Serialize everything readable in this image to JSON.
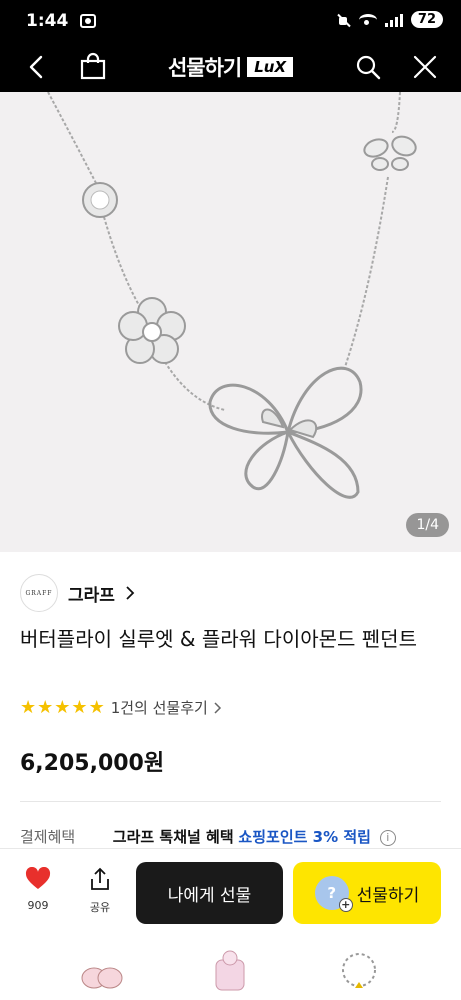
{
  "status_bar": {
    "time": "1:44",
    "battery": "72"
  },
  "header": {
    "title": "선물하기",
    "badge": "LuX",
    "icons": [
      "back-icon",
      "shopping-bag-icon",
      "search-icon",
      "close-icon"
    ]
  },
  "hero": {
    "page_indicator": "1/4"
  },
  "brand": {
    "logo_text": "GRAFF",
    "name": "그라프"
  },
  "product": {
    "title": "버터플라이 실루엣 & 플라워 다이아몬드 펜던트",
    "rating_stars": 5,
    "review_text": "1건의 선물후기",
    "price": "6,205,000원"
  },
  "benefit": {
    "label": "결제혜택",
    "text": "그라프 톡채널 혜택",
    "highlight": "쇼핑포인트 3% 적립"
  },
  "action_bar": {
    "like_count": "909",
    "share_label": "공유",
    "gift_self_label": "나에게 선물",
    "gift_label": "선물하기",
    "avatar_symbol": "?"
  },
  "colors": {
    "header_bg": "#000000",
    "gift_button_bg": "#fee500",
    "star": "#f5c100",
    "highlight": "#1a56c4",
    "heart": "#e8302c"
  }
}
